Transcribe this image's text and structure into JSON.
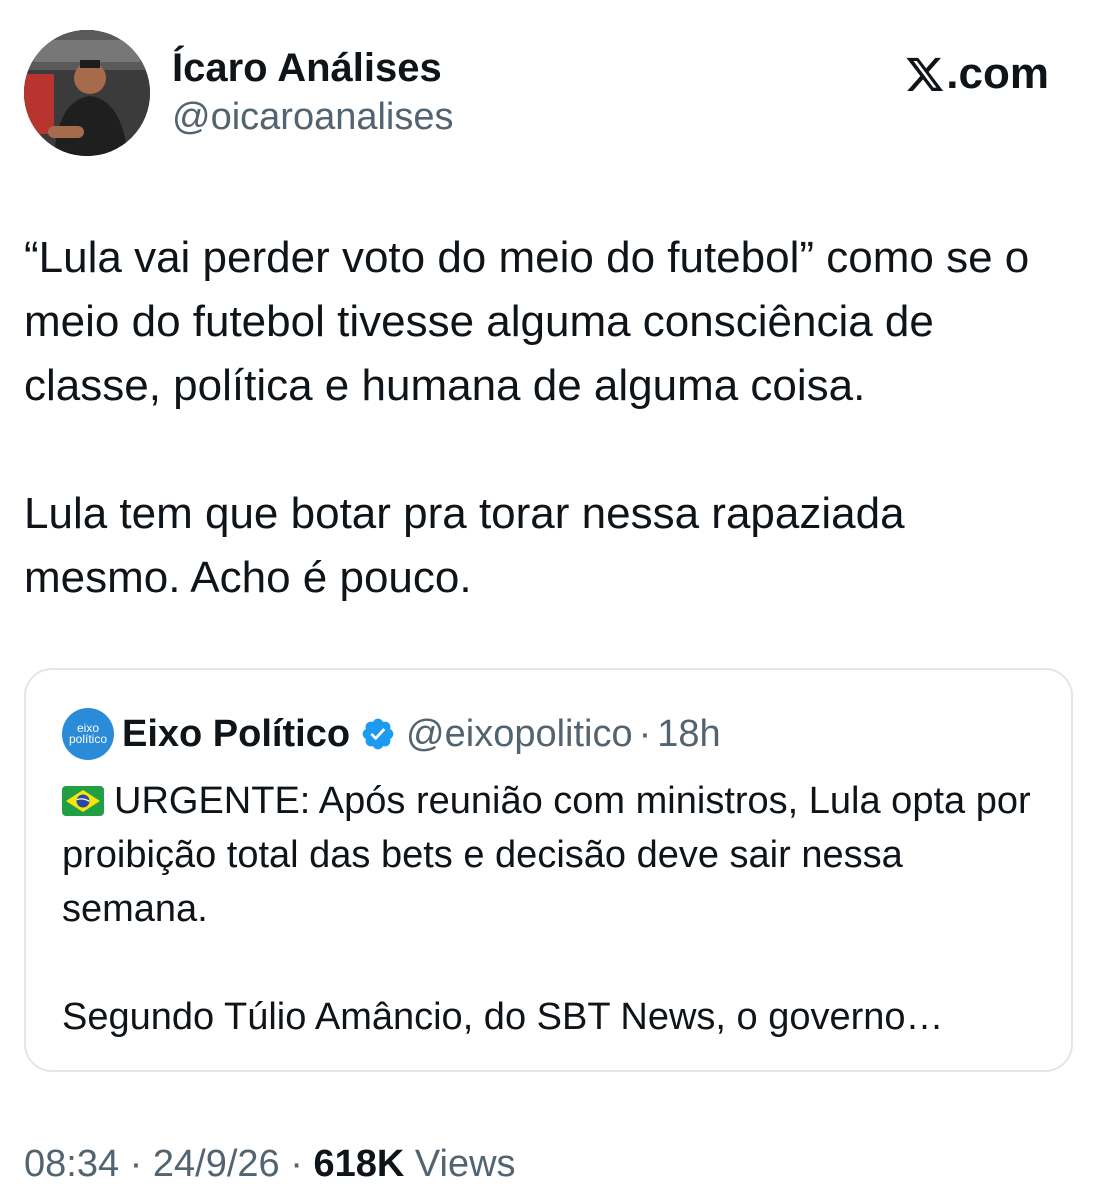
{
  "author": {
    "display_name": "Ícaro Análises",
    "handle": "@oicaroanalises",
    "avatar_icon": "profile-photo"
  },
  "brand": {
    "label": ".com",
    "logo_icon": "x-logo-icon"
  },
  "tweet": {
    "paragraphs": [
      "“Lula vai perder voto do meio do futebol” como se o meio do futebol tivesse alguma consciência de classe, política e humana de alguma coisa.",
      "Lula tem que botar pra torar nessa rapaziada mesmo. Acho é pouco."
    ]
  },
  "quote": {
    "avatar_text_line1": "eixo",
    "avatar_text_line2": "político",
    "display_name": "Eixo Político",
    "verified_icon": "verified-badge-icon",
    "handle": "@eixopolitico",
    "separator": "·",
    "time": "18h",
    "flag_icon": "brazil-flag-icon",
    "paragraphs": [
      "URGENTE: Após reunião com ministros, Lula opta por proibição total das bets e decisão deve sair nessa semana.",
      "Segundo Túlio Amâncio, do SBT News, o governo…"
    ]
  },
  "footer": {
    "time": "08:34",
    "separator": "·",
    "date": "24/9/26",
    "views_count": "618K",
    "views_label": "Views"
  },
  "colors": {
    "text_primary": "#0f1419",
    "text_secondary": "#536471",
    "border": "#e1e6ea",
    "verified_blue": "#1d9bf0",
    "quote_avatar": "#2a8bd9"
  }
}
